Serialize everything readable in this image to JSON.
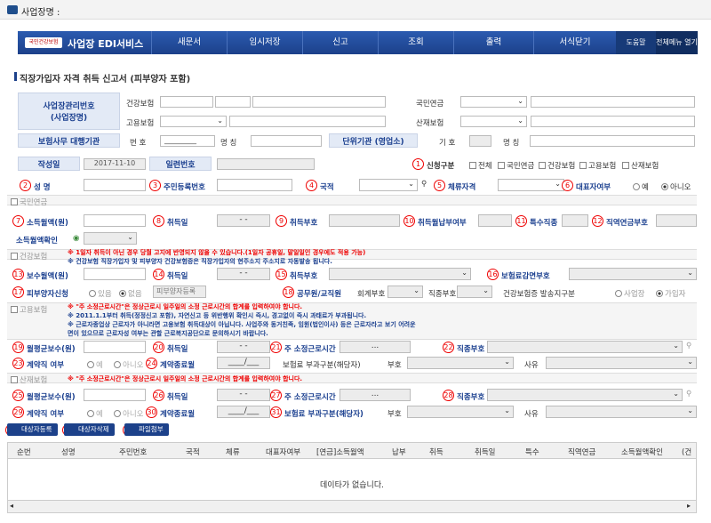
{
  "top_title": "사업장명 :",
  "nav": {
    "brand": "사업장 EDI서비스",
    "logo": "국민건강보험",
    "menu": [
      "새문서",
      "임시저장",
      "신고",
      "조회",
      "출력",
      "서식닫기"
    ],
    "help": "도움말",
    "all": "전체메뉴 열기"
  },
  "page_title": "직장가입자 자격 취득 신고서 (피부양자 포함)",
  "biz": {
    "label": "사업장관리번호\n(사업장명)",
    "health": "건강보험",
    "pension": "국민연금",
    "employment": "고용보험",
    "accident": "산재보험",
    "agent": "보험사무 대행기관",
    "no": "번 호",
    "no_value": "_________",
    "name": "명 칭",
    "unit": "단위기관 (영업소)",
    "code": "기 호",
    "name2": "명 칭"
  },
  "form": {
    "date_label": "작성일",
    "date": "2017-11-10",
    "serial": "일련번호",
    "report_type": "신청구분",
    "opts": [
      "전체",
      "국민연금",
      "건강보험",
      "고용보험",
      "산재보험"
    ],
    "name": "성  명",
    "rrn": "주민등록번호",
    "nation": "국적",
    "stay": "체류자격",
    "rep": "대표자여부",
    "yes": "예",
    "no": "아니오"
  },
  "nums": [
    "1",
    "2",
    "3",
    "4",
    "5",
    "6",
    "7",
    "8",
    "9",
    "10",
    "11",
    "12",
    "13",
    "14",
    "15",
    "16",
    "17",
    "18",
    "19",
    "20",
    "21",
    "22",
    "23",
    "24",
    "25",
    "26",
    "27",
    "28",
    "29",
    "30",
    "31",
    "32",
    "33",
    "34"
  ],
  "pension": {
    "sec": "국민연금",
    "income": "소득월액(원)",
    "acq": "취득일",
    "acq_code": "취득부호",
    "pay": "취득월납부여부",
    "special": "특수직종",
    "job": "직역연금부호",
    "confirm": "소득월액확인"
  },
  "health": {
    "sec": "건강보험",
    "note1": "※ 1일자 취득이 아닌 경우 당월 고지에 반영되지 않을 수 있습니다.(1일자 공휴일, 말일일인 경우에도 적용 가능)",
    "note2": "※ 건강보험 직장가입자 및 피부양자 건강보험증은 직장가입자의 현주소지 주소지로 자동발송 됩니다.",
    "wage": "보수월액(원)",
    "acq": "취득일",
    "acq_code": "취득부호",
    "reduce": "보험료감면부호",
    "dep": "피부양자신청",
    "have": "있음",
    "none": "없음",
    "dep_reg": "피부양자등록",
    "civil": "공무원/교직원",
    "account": "회계부호",
    "job_code": "직종부호",
    "card": "건강보험증 발송지구분",
    "site": "사업장",
    "member": "가입자"
  },
  "emp": {
    "sec": "고용보험",
    "note1": "※ \"주 소정근로시간\"은 정상근로시 일주일의 소정 근로시간의 합계를 입력하여야 합니다.",
    "note2": "※ 2011.1.1부터 취득(정정신고 포함), 자연신고 등 위반행위 확인시 즉시, 경고없이 즉시 과태료가 부과됩니다.",
    "note3": "※ 근로자종업상 근로자가 아니라면 고용보험 취득대상이 아닙니다. 사업주와 동거친족, 임원(법인이사) 등은 근로자라고 보기 어려운",
    "note4": "   면이 있으므로 근로자성 여부는 관할 근로복지공단으로 문의하시기 바랍니다.",
    "avg": "월평균보수(원)",
    "acq": "취득일",
    "hours": "주 소정근로시간",
    "job": "직종부호",
    "contract": "계약직 여부",
    "yes": "예",
    "no": "아니오",
    "end": "계약종료월",
    "levy": "보험료 부과구분(해당자)",
    "code": "부호",
    "reason": "사유",
    "dash": "- -",
    "dots": "...",
    "month": "____/___"
  },
  "acc": {
    "sec": "산재보험",
    "note": "※ \"주 소정근로시간\"은 정상근로시 일주일의 소정 근로시간의 합계를 입력하여야 합니다."
  },
  "buttons": [
    "대상자등록",
    "대상자삭제",
    "파일첨부"
  ],
  "grid": {
    "cols": [
      "순번",
      "성명",
      "주민번호",
      "국적",
      "체류",
      "대표자여부",
      "[연금]소득월액",
      "납부",
      "취득",
      "취득일",
      "특수",
      "직역연금",
      "소득월액확인",
      "(건"
    ],
    "empty": "데이타가 없습니다."
  }
}
